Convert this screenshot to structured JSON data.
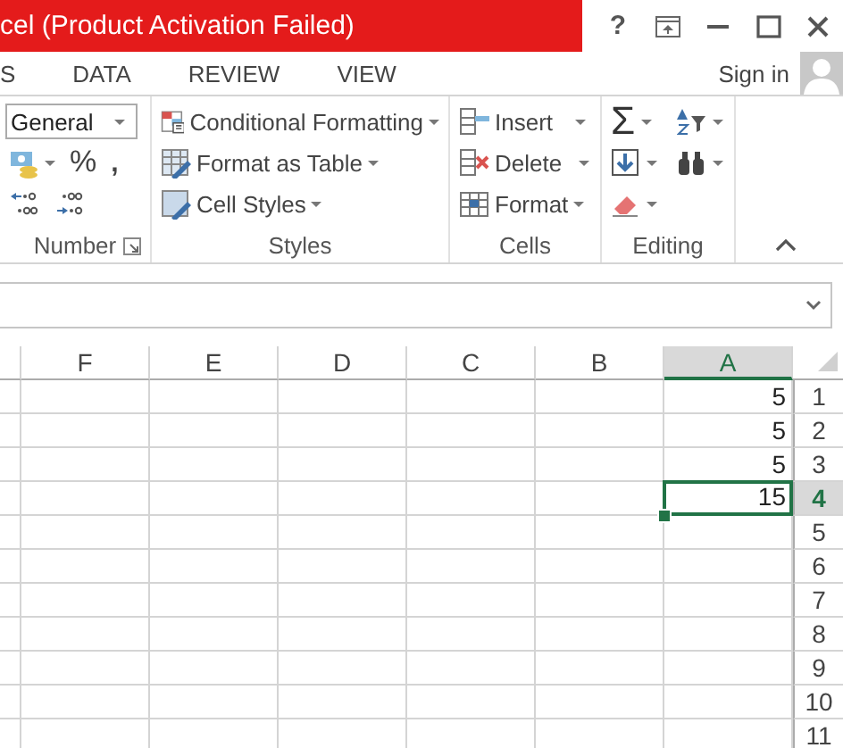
{
  "window": {
    "title": "cel (Product Activation Failed)",
    "help": "?"
  },
  "tabs": [
    {
      "label": "S",
      "selected": false
    },
    {
      "label": "DATA",
      "selected": false
    },
    {
      "label": "REVIEW",
      "selected": false
    },
    {
      "label": "VIEW",
      "selected": false
    }
  ],
  "account": {
    "label": "Sign in"
  },
  "ribbon": {
    "groups": [
      {
        "kind": "number",
        "label": "Number",
        "format": "General",
        "buttons": [
          "%",
          ","
        ]
      },
      {
        "kind": "styles",
        "label": "Styles",
        "commands": [
          "Conditional Formatting",
          "Format as Table",
          "Cell Styles"
        ]
      },
      {
        "kind": "cells",
        "label": "Cells",
        "commands": [
          "Insert",
          "Delete",
          "Format"
        ]
      },
      {
        "kind": "editing",
        "label": "Editing",
        "autosum": "Σ"
      }
    ]
  },
  "sheet": {
    "columns": [
      {
        "label": "F",
        "selected": false
      },
      {
        "label": "E",
        "selected": false
      },
      {
        "label": "D",
        "selected": false
      },
      {
        "label": "C",
        "selected": false
      },
      {
        "label": "B",
        "selected": false
      },
      {
        "label": "A",
        "selected": true
      }
    ],
    "rows": [
      {
        "header": "1",
        "selected": false,
        "value": "5"
      },
      {
        "header": "2",
        "selected": false,
        "value": "5"
      },
      {
        "header": "3",
        "selected": false,
        "value": "5"
      },
      {
        "header": "4",
        "selected": true,
        "value": "15"
      },
      {
        "header": "5",
        "selected": false
      },
      {
        "header": "6",
        "selected": false
      },
      {
        "header": "7",
        "selected": false
      },
      {
        "header": "8",
        "selected": false
      },
      {
        "header": "9",
        "selected": false
      },
      {
        "header": "10",
        "selected": false
      },
      {
        "header": "11",
        "selected": false
      }
    ]
  }
}
